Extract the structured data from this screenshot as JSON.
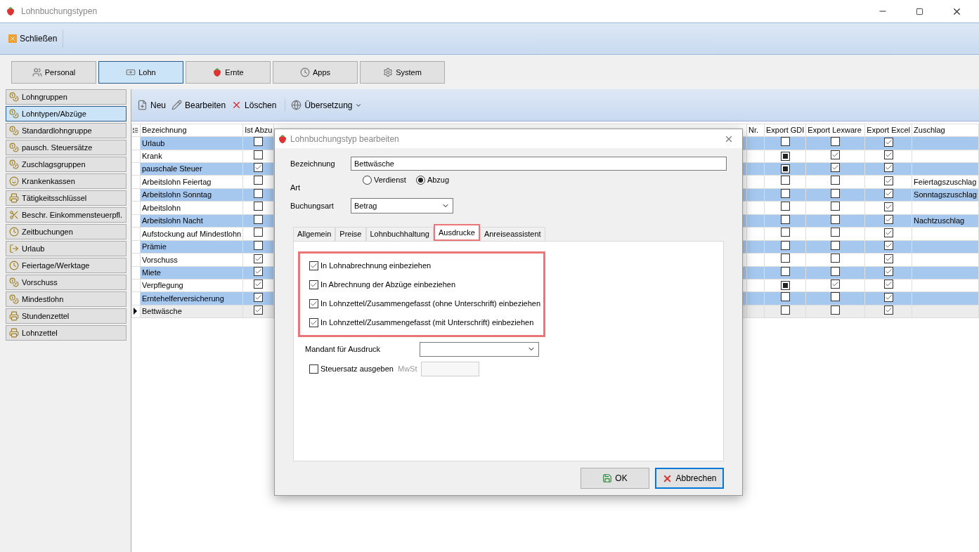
{
  "window": {
    "title": "Lohnbuchungstypen"
  },
  "toolbar": {
    "close_label": "Schließen"
  },
  "modules": [
    {
      "label": "Personal",
      "selected": false
    },
    {
      "label": "Lohn",
      "selected": true
    },
    {
      "label": "Ernte",
      "selected": false
    },
    {
      "label": "Apps",
      "selected": false
    },
    {
      "label": "System",
      "selected": false
    }
  ],
  "sidebar": {
    "items": [
      {
        "label": "Lohngruppen",
        "selected": false
      },
      {
        "label": "Lohntypen/Abzüge",
        "selected": true
      },
      {
        "label": "Standardlohngruppe",
        "selected": false
      },
      {
        "label": "pausch. Steuersätze",
        "selected": false
      },
      {
        "label": "Zuschlagsgruppen",
        "selected": false
      },
      {
        "label": "Krankenkassen",
        "selected": false
      },
      {
        "label": "Tätigkeitsschlüssel",
        "selected": false
      },
      {
        "label": "Beschr. Einkommensteuerpfl.",
        "selected": false
      },
      {
        "label": "Zeitbuchungen",
        "selected": false
      },
      {
        "label": "Urlaub",
        "selected": false
      },
      {
        "label": "Feiertage/Werktage",
        "selected": false
      },
      {
        "label": "Vorschuss",
        "selected": false
      },
      {
        "label": "Mindestlohn",
        "selected": false
      },
      {
        "label": "Stundenzettel",
        "selected": false
      },
      {
        "label": "Lohnzettel",
        "selected": false
      }
    ]
  },
  "actions": [
    {
      "label": "Neu"
    },
    {
      "label": "Bearbeiten"
    },
    {
      "label": "Löschen"
    },
    {
      "label": "Übersetzung",
      "dropdown": true
    }
  ],
  "table": {
    "columns": [
      "Bezeichnung",
      "Ist Abzu",
      "Nr.",
      "Export GDI",
      "Export Lexware",
      "Export Excel",
      "Zuschlag"
    ],
    "rows": [
      {
        "name": "Urlaub",
        "ist_abzug": false,
        "export_gdi": false,
        "export_lexware": false,
        "export_excel": true,
        "zuschlag": "",
        "current": false
      },
      {
        "name": "Krank",
        "ist_abzug": false,
        "export_gdi": true,
        "export_lexware": true,
        "export_excel": true,
        "zuschlag": "",
        "current": false
      },
      {
        "name": "pauschale Steuer",
        "ist_abzug": true,
        "export_gdi": true,
        "export_lexware": true,
        "export_excel": true,
        "zuschlag": "",
        "current": false
      },
      {
        "name": "Arbeitslohn Feiertag",
        "ist_abzug": false,
        "export_gdi": false,
        "export_lexware": false,
        "export_excel": true,
        "zuschlag": "Feiertagszuschlag",
        "current": false
      },
      {
        "name": "Arbeitslohn Sonntag",
        "ist_abzug": false,
        "export_gdi": false,
        "export_lexware": false,
        "export_excel": true,
        "zuschlag": "Sonntagszuschlag",
        "current": false
      },
      {
        "name": "Arbeitslohn",
        "ist_abzug": false,
        "export_gdi": false,
        "export_lexware": false,
        "export_excel": true,
        "zuschlag": "",
        "current": false
      },
      {
        "name": "Arbeitslohn Nacht",
        "ist_abzug": false,
        "export_gdi": false,
        "export_lexware": false,
        "export_excel": true,
        "zuschlag": "Nachtzuschlag",
        "current": false
      },
      {
        "name": "Aufstockung auf Mindestlohn",
        "ist_abzug": false,
        "export_gdi": false,
        "export_lexware": false,
        "export_excel": true,
        "zuschlag": "",
        "current": false
      },
      {
        "name": "Prämie",
        "ist_abzug": false,
        "export_gdi": false,
        "export_lexware": false,
        "export_excel": true,
        "zuschlag": "",
        "current": false
      },
      {
        "name": "Vorschuss",
        "ist_abzug": true,
        "export_gdi": false,
        "export_lexware": false,
        "export_excel": true,
        "zuschlag": "",
        "current": false
      },
      {
        "name": "Miete",
        "ist_abzug": true,
        "export_gdi": false,
        "export_lexware": false,
        "export_excel": true,
        "zuschlag": "",
        "current": false
      },
      {
        "name": "Verpflegung",
        "ist_abzug": true,
        "export_gdi": true,
        "export_lexware": true,
        "export_excel": true,
        "zuschlag": "",
        "current": false
      },
      {
        "name": "Erntehelferversicherung",
        "ist_abzug": true,
        "export_gdi": false,
        "export_lexware": false,
        "export_excel": true,
        "zuschlag": "",
        "current": false
      },
      {
        "name": "Bettwäsche",
        "ist_abzug": true,
        "export_gdi": false,
        "export_lexware": false,
        "export_excel": true,
        "zuschlag": "",
        "current": true
      }
    ]
  },
  "dialog": {
    "title": "Lohnbuchungstyp bearbeiten",
    "bezeichnung": {
      "label": "Bezeichnung",
      "value": "Bettwäsche"
    },
    "art": {
      "label": "Art",
      "options": [
        {
          "label": "Verdienst",
          "selected": false
        },
        {
          "label": "Abzug",
          "selected": true
        }
      ]
    },
    "buchungsart": {
      "label": "Buchungsart",
      "value": "Betrag"
    },
    "tabs": [
      {
        "label": "Allgemein",
        "selected": false
      },
      {
        "label": "Preise",
        "selected": false
      },
      {
        "label": "Lohnbuchhaltung",
        "selected": false
      },
      {
        "label": "Ausdrucke",
        "selected": true
      },
      {
        "label": "Anreiseassistent",
        "selected": false
      }
    ],
    "checkboxes": [
      {
        "label": "In Lohnabrechnung einbeziehen",
        "checked": true
      },
      {
        "label": "In Abrechnung der Abzüge einbeziehen",
        "checked": true
      },
      {
        "label": "In Lohnzettel/Zusammengefasst (ohne Unterschrift) einbeziehen",
        "checked": true
      },
      {
        "label": "In Lohnzettel/Zusammengefasst (mit Unterschrift) einbeziehen",
        "checked": true
      }
    ],
    "mandant": {
      "label": "Mandant für Ausdruck"
    },
    "steuersatz": {
      "label": "Steuersatz ausgeben",
      "checked": false
    },
    "mwst": {
      "label": "MwSt",
      "disabled": true
    },
    "buttons": [
      {
        "label": "OK",
        "focused": false
      },
      {
        "label": "Abbrechen",
        "focused": true
      }
    ]
  }
}
